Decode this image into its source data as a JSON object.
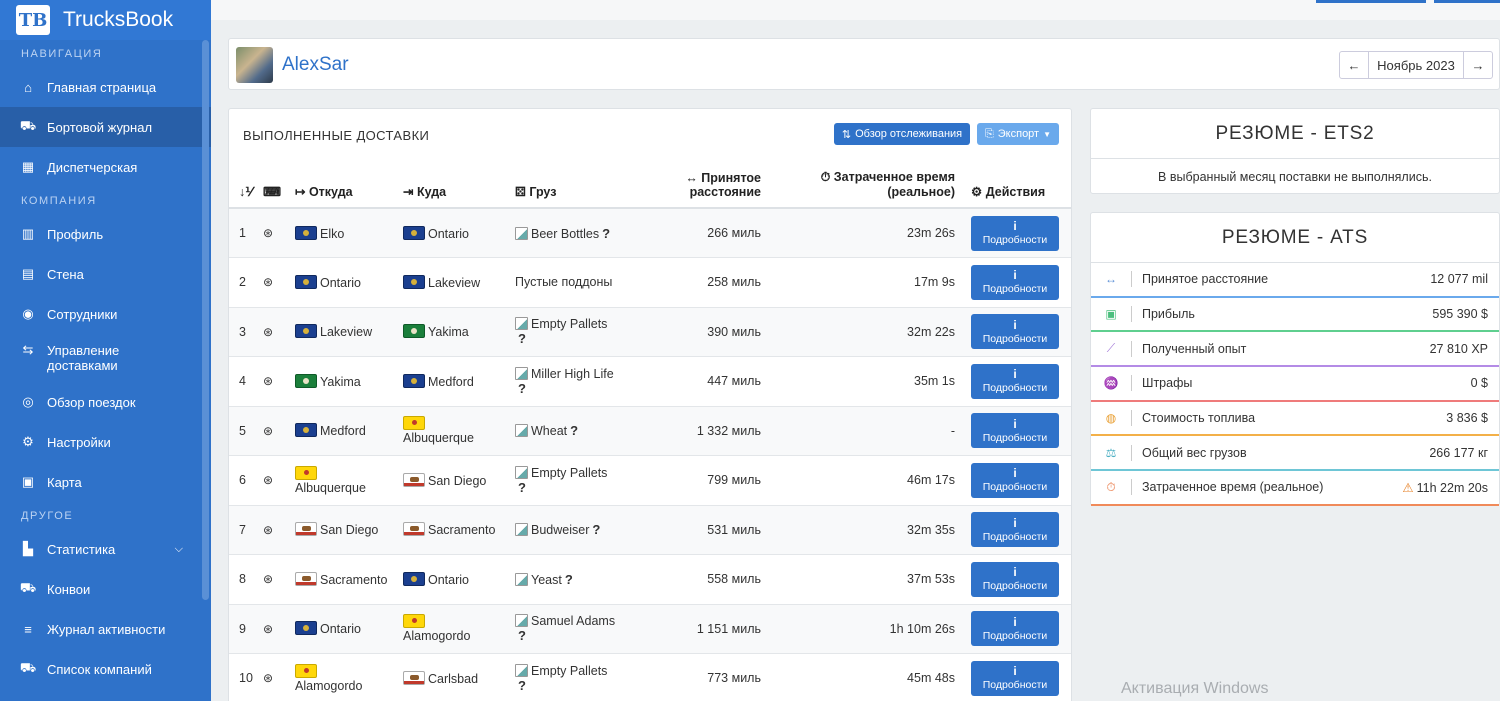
{
  "brand": {
    "logo": "TB",
    "name": "TrucksBook"
  },
  "sidebar": {
    "sections": [
      {
        "title": "НАВИГАЦИЯ",
        "items": [
          {
            "label": "Главная страница",
            "icon": "home-icon",
            "glyph": "⌂"
          },
          {
            "label": "Бортовой журнал",
            "icon": "truck-icon",
            "glyph": "⛟",
            "active": true
          },
          {
            "label": "Диспетчерская",
            "icon": "dispatch-icon",
            "glyph": "▦"
          }
        ]
      },
      {
        "title": "КОМПАНИЯ",
        "items": [
          {
            "label": "Профиль",
            "icon": "building-icon",
            "glyph": "▥"
          },
          {
            "label": "Стена",
            "icon": "comment-icon",
            "glyph": "▤"
          },
          {
            "label": "Сотрудники",
            "icon": "users-icon",
            "glyph": "◉"
          },
          {
            "label": "Управление доставками",
            "icon": "route-icon",
            "glyph": "⇆",
            "tall": true
          },
          {
            "label": "Обзор поездок",
            "icon": "trip-icon",
            "glyph": "◎"
          },
          {
            "label": "Настройки",
            "icon": "gear-icon",
            "glyph": "⚙"
          },
          {
            "label": "Карта",
            "icon": "map-icon",
            "glyph": "▣"
          }
        ]
      },
      {
        "title": "ДРУГОЕ",
        "items": [
          {
            "label": "Статистика",
            "icon": "chart-icon",
            "glyph": "▙",
            "chevron": true
          },
          {
            "label": "Конвои",
            "icon": "convoy-icon",
            "glyph": "⛟"
          },
          {
            "label": "Журнал активности",
            "icon": "list-icon",
            "glyph": "≡"
          },
          {
            "label": "Список компаний",
            "icon": "companies-icon",
            "glyph": "⛟"
          }
        ]
      }
    ]
  },
  "profile": {
    "name": "AlexSar"
  },
  "month_nav": {
    "prev": "←",
    "label": "Ноябрь 2023",
    "next": "→"
  },
  "deliveries": {
    "title": "ВЫПОЛНЕННЫЕ ДОСТАВКИ",
    "track_button": "Обзор отслеживания",
    "export_button": "Экспорт",
    "headers": {
      "num": "↓⅟",
      "from": "Откуда",
      "to": "Куда",
      "cargo": "Груз",
      "distance_1": "Принятое",
      "distance_2": "расстояние",
      "time_1": "Затраченное время",
      "time_2": "(реальное)",
      "actions": "Действия"
    },
    "details_label": "Подробности",
    "rows": [
      {
        "n": "1",
        "from": "Elko",
        "from_flag": "nv",
        "to": "Ontario",
        "to_flag": "or",
        "cargo": "Beer Bottles",
        "cargo_img": true,
        "q": true,
        "distance": "266 миль",
        "time": "23m 26s"
      },
      {
        "n": "2",
        "from": "Ontario",
        "from_flag": "or",
        "to": "Lakeview",
        "to_flag": "or",
        "cargo": "Пустые поддоны",
        "cargo_img": false,
        "q": false,
        "distance": "258 миль",
        "time": "17m 9s"
      },
      {
        "n": "3",
        "from": "Lakeview",
        "from_flag": "or",
        "to": "Yakima",
        "to_flag": "wa",
        "cargo": "Empty Pallets",
        "cargo_img": true,
        "q": true,
        "qbreak": true,
        "distance": "390 миль",
        "time": "32m 22s"
      },
      {
        "n": "4",
        "from": "Yakima",
        "from_flag": "wa",
        "to": "Medford",
        "to_flag": "or",
        "cargo": "Miller High Life",
        "cargo_img": true,
        "q": true,
        "qbreak": true,
        "distance": "447 миль",
        "time": "35m 1s"
      },
      {
        "n": "5",
        "from": "Medford",
        "from_flag": "or",
        "to": "Albuquerque",
        "to_flag": "nm",
        "to_break": true,
        "cargo": "Wheat",
        "cargo_img": true,
        "q": true,
        "distance": "1 332 миль",
        "time": "-"
      },
      {
        "n": "6",
        "from": "Albuquerque",
        "from_flag": "nm",
        "from_break": true,
        "to": "San Diego",
        "to_flag": "ca",
        "cargo": "Empty Pallets",
        "cargo_img": true,
        "q": true,
        "qbreak": true,
        "distance": "799 миль",
        "time": "46m 17s"
      },
      {
        "n": "7",
        "from": "San Diego",
        "from_flag": "ca",
        "to": "Sacramento",
        "to_flag": "ca",
        "cargo": "Budweiser",
        "cargo_img": true,
        "q": true,
        "distance": "531 миль",
        "time": "32m 35s"
      },
      {
        "n": "8",
        "from": "Sacramento",
        "from_flag": "ca",
        "to": "Ontario",
        "to_flag": "or",
        "cargo": "Yeast",
        "cargo_img": true,
        "q": true,
        "distance": "558 миль",
        "time": "37m 53s"
      },
      {
        "n": "9",
        "from": "Ontario",
        "from_flag": "or",
        "to": "Alamogordo",
        "to_flag": "nm",
        "to_break": true,
        "cargo": "Samuel Adams",
        "cargo_img": true,
        "q": true,
        "qbreak": true,
        "distance": "1 151 миль",
        "time": "1h 10m 26s"
      },
      {
        "n": "10",
        "from": "Alamogordo",
        "from_flag": "nm",
        "from_break": true,
        "to": "Carlsbad",
        "to_flag": "ca",
        "cargo": "Empty Pallets",
        "cargo_img": true,
        "q": true,
        "qbreak": true,
        "distance": "773 миль",
        "time": "45m 48s"
      }
    ]
  },
  "summary_ets2": {
    "title": "РЕЗЮМЕ - ETS2",
    "empty": "В выбранный месяц поставки не выполнялись."
  },
  "summary_ats": {
    "title": "РЕЗЮМЕ - ATS",
    "rows": [
      {
        "label": "Принятое расстояние",
        "value": "12 077 mil",
        "icon": "distance-icon",
        "glyph": "↔",
        "color": "#6aa9ec",
        "iconColor": "#5b8fd6"
      },
      {
        "label": "Прибыль",
        "value": "595 390 $",
        "icon": "money-icon",
        "glyph": "▣",
        "color": "#5fcf8f",
        "iconColor": "#4cbf7e"
      },
      {
        "label": "Полученный опыт",
        "value": "27 810 XP",
        "icon": "chart-line-icon",
        "glyph": "⟋",
        "color": "#b48be6",
        "iconColor": "#a37ad8"
      },
      {
        "label": "Штрафы",
        "value": "0 $",
        "icon": "police-icon",
        "glyph": "♒",
        "color": "#ef7b7b",
        "iconColor": "#e26a6a"
      },
      {
        "label": "Стоимость топлива",
        "value": "3 836 $",
        "icon": "fuel-icon",
        "glyph": "◍",
        "color": "#f3b048",
        "iconColor": "#e89d2e"
      },
      {
        "label": "Общий вес грузов",
        "value": "266 177 кг",
        "icon": "scale-icon",
        "glyph": "⚖",
        "color": "#6ec6d6",
        "iconColor": "#4bafc3"
      },
      {
        "label": "Затраченное время (реальное)",
        "value": "11h 22m 20s",
        "icon": "stopwatch-icon",
        "glyph": "⏱",
        "color": "#f08a5a",
        "iconColor": "#e8743f",
        "warn": "⚠"
      }
    ]
  },
  "watermark": "Активация Windows"
}
